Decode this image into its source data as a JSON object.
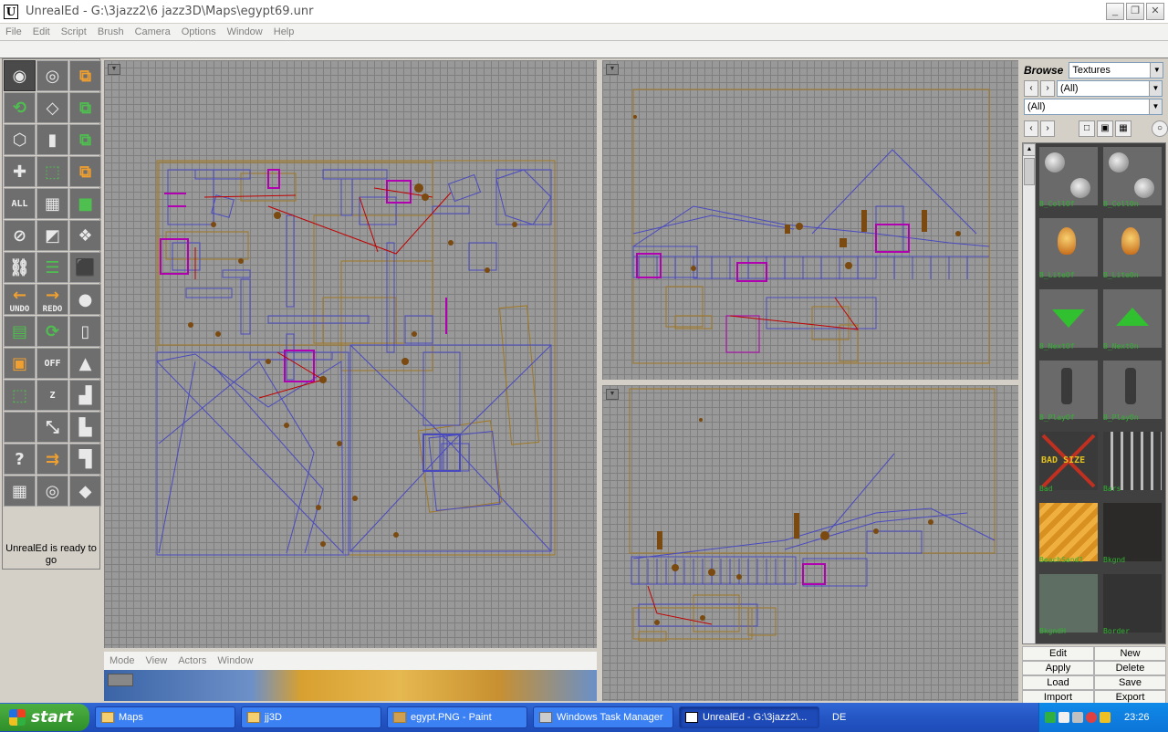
{
  "window": {
    "title": "UnrealEd - G:\\3jazz2\\6 jazz3D\\Maps\\egypt69.unr",
    "minimize": "_",
    "maximize": "❐",
    "close": "✕"
  },
  "menu": [
    "File",
    "Edit",
    "Script",
    "Brush",
    "Camera",
    "Options",
    "Window",
    "Help"
  ],
  "toolbox": {
    "tools": [
      {
        "name": "camera-move-icon",
        "glyph": "◉",
        "active": true
      },
      {
        "name": "camera-zoom-icon",
        "glyph": "◎"
      },
      {
        "name": "brush-clip-icon",
        "glyph": "⧉",
        "c": "orange"
      },
      {
        "name": "brush-rotate-icon",
        "glyph": "⟲",
        "c": "green"
      },
      {
        "name": "brush-scale-icon",
        "glyph": "◇"
      },
      {
        "name": "texture-pan-icon",
        "glyph": "⧉",
        "c": "green"
      },
      {
        "name": "vertex-edit-icon",
        "glyph": "⬡"
      },
      {
        "name": "brush-height-icon",
        "glyph": "▮"
      },
      {
        "name": "texture-rotate-icon",
        "glyph": "⧉",
        "c": "green"
      },
      {
        "name": "actor-add-icon",
        "glyph": "✚"
      },
      {
        "name": "select-icon",
        "glyph": "⬚",
        "c": "green"
      },
      {
        "name": "mirror-icon",
        "glyph": "⧉",
        "c": "orange"
      },
      {
        "name": "select-all-icon",
        "text": "ALL"
      },
      {
        "name": "snap-grid-icon",
        "glyph": "▦"
      },
      {
        "name": "grid-toggle-icon",
        "glyph": "■",
        "c": "green"
      },
      {
        "name": "no-icon",
        "glyph": "⊘"
      },
      {
        "name": "texture-select-icon",
        "glyph": "◩"
      },
      {
        "name": "cube-sheet-icon",
        "glyph": "❖"
      },
      {
        "name": "link-icon",
        "glyph": "⛓"
      },
      {
        "name": "list-icon",
        "glyph": "☰",
        "c": "green"
      },
      {
        "name": "cube-icon",
        "glyph": "⬛"
      },
      {
        "name": "undo-icon",
        "glyph": "←",
        "c": "orange"
      },
      {
        "name": "redo-icon",
        "glyph": "→",
        "c": "orange"
      },
      {
        "name": "sphere-icon",
        "glyph": "●"
      },
      {
        "name": "copy-icon",
        "glyph": "▤",
        "c": "green"
      },
      {
        "name": "refresh-icon",
        "glyph": "⟳",
        "c": "green"
      },
      {
        "name": "cylinder-icon",
        "glyph": "▯"
      },
      {
        "name": "select-box-icon",
        "glyph": "▣",
        "c": "orange"
      },
      {
        "name": "off-icon",
        "text": "OFF"
      },
      {
        "name": "cone-icon",
        "glyph": "▲"
      },
      {
        "name": "intersect-icon",
        "glyph": "⬚",
        "c": "green"
      },
      {
        "name": "zone-icon",
        "text": "Z"
      },
      {
        "name": "stairs-icon",
        "glyph": "▟"
      },
      {
        "name": "empty-tool-icon",
        "glyph": ""
      },
      {
        "name": "path-icon",
        "glyph": "⤡"
      },
      {
        "name": "spiral-stairs-icon",
        "glyph": "▙"
      },
      {
        "name": "hook-icon",
        "glyph": "?"
      },
      {
        "name": "move-arrow-icon",
        "glyph": "⇉",
        "c": "orange"
      },
      {
        "name": "curved-stairs-icon",
        "glyph": "▜"
      },
      {
        "name": "grid-icon",
        "glyph": "▦"
      },
      {
        "name": "radar-icon",
        "glyph": "◎"
      },
      {
        "name": "sheet-icon",
        "glyph": "◆"
      }
    ],
    "texts": {
      "all": "ALL",
      "off": "OFF",
      "undo": "UNDO",
      "redo": "REDO",
      "z": "Z"
    },
    "status": "UnrealEd is ready to go"
  },
  "viewport3d_menu": [
    "Mode",
    "View",
    "Actors",
    "Window"
  ],
  "browser": {
    "label": "Browse",
    "type": "Textures",
    "package": "(All)",
    "group": "(All)",
    "textures": [
      {
        "name": "B_CollOf",
        "style": "t-sphere"
      },
      {
        "name": "B_CollOn",
        "style": "t-sphere"
      },
      {
        "name": "B_LiteOf",
        "style": "t-torch"
      },
      {
        "name": "B_LiteOn",
        "style": "t-torch"
      },
      {
        "name": "B_NextOf",
        "style": "t-arrow-down"
      },
      {
        "name": "B_NextOn",
        "style": "t-arrow-up"
      },
      {
        "name": "B_PlayOf",
        "style": "t-lever"
      },
      {
        "name": "B_PlayOn",
        "style": "t-lever"
      },
      {
        "name": "Bad",
        "style": "t-bad"
      },
      {
        "name": "Bars",
        "style": "t-bars"
      },
      {
        "name": "BeachSand1",
        "style": "t-sand"
      },
      {
        "name": "Bkgnd",
        "style": "t-dark"
      },
      {
        "name": "BkgndH",
        "style": "t-green"
      },
      {
        "name": "Border",
        "style": "t-void"
      }
    ],
    "bad_text": "BAD SIZE",
    "buttons": [
      "Edit",
      "New",
      "Apply",
      "Delete",
      "Load",
      "Save",
      "Import",
      "Export"
    ]
  },
  "taskbar": {
    "start": "start",
    "tasks": [
      {
        "label": "Maps",
        "icon": "folder"
      },
      {
        "label": "jj3D",
        "icon": "folder"
      },
      {
        "label": "egypt.PNG - Paint",
        "icon": "paint"
      },
      {
        "label": "Windows Task Manager",
        "icon": "tm"
      },
      {
        "label": "UnrealEd - G:\\3jazz2\\...",
        "icon": "ue",
        "active": true
      }
    ],
    "lang": "DE",
    "clock": "23:26"
  },
  "colors": {
    "brush_blue": "#4a4ac0",
    "brush_gold": "#a07820",
    "actor_brown": "#7a4a10",
    "path_red": "#c00000",
    "selected_magenta": "#b000b0",
    "viewport_gray": "#999999",
    "grid_line": "#7f7f7f"
  }
}
